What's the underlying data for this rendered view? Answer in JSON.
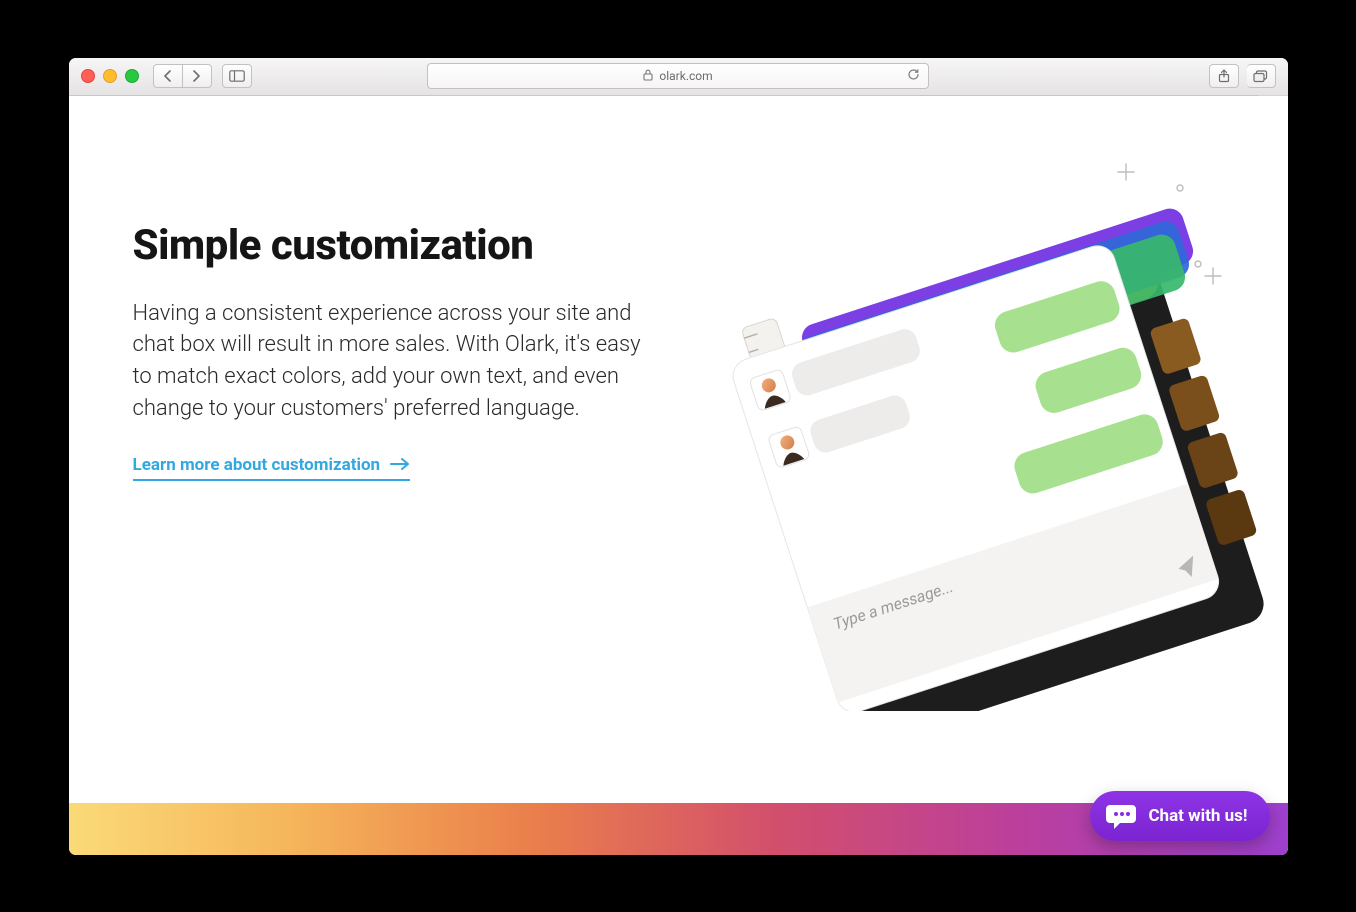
{
  "browser": {
    "url_host": "olark.com"
  },
  "hero": {
    "title": "Simple customization",
    "paragraph": "Having a consistent experience across your site and chat box will result in more sales. With Olark, it's easy to match exact colors, add your own text, and even change to your customers' preferred language.",
    "cta": "Learn more about customization"
  },
  "illustration": {
    "placeholder": "Type a message..."
  },
  "chat": {
    "label": "Chat with us!"
  }
}
